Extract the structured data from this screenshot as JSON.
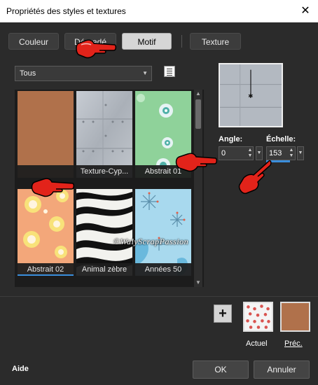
{
  "window": {
    "title": "Propriétés des styles et textures",
    "close_glyph": "✕"
  },
  "tabs": [
    {
      "label": "Couleur",
      "active": false
    },
    {
      "label": "Dégradé",
      "active": false
    },
    {
      "label": "Motif",
      "active": true
    },
    {
      "label": "Texture",
      "active": false
    }
  ],
  "filter": {
    "selected": "Tous",
    "list_icon": "list-view-icon"
  },
  "patterns": [
    {
      "label": "",
      "icon": "solid-brown-swatch",
      "color": "#b0714b"
    },
    {
      "label": "Texture-Cyp...",
      "icon": "metal-plate-texture"
    },
    {
      "label": "Abstrait 01",
      "icon": "green-circles-pattern"
    },
    {
      "label": "Abstrait 02",
      "icon": "orange-circles-pattern",
      "underlined": true
    },
    {
      "label": "Animal zèbre",
      "icon": "zebra-stripes-pattern"
    },
    {
      "label": "Années 50",
      "icon": "blue-starburst-pattern"
    }
  ],
  "angle": {
    "label": "Angle:",
    "value": "0"
  },
  "scale": {
    "label": "Échelle:",
    "value": "153"
  },
  "watermark": "©WalyScrapPassion",
  "swatches": {
    "current_label": "Actuel",
    "previous_label": "Préc.",
    "previous_color": "#b0714b"
  },
  "footer": {
    "help": "Aide",
    "ok": "OK",
    "cancel": "Annuler"
  }
}
